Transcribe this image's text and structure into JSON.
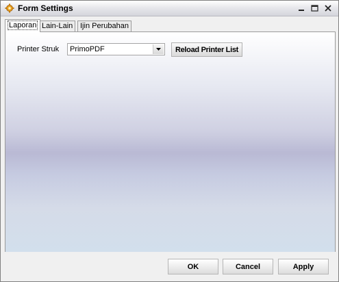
{
  "window": {
    "title": "Form Settings",
    "app_icon": "gear-icon",
    "controls": [
      "minimize-icon",
      "maximize-icon",
      "close-icon"
    ]
  },
  "tabs": [
    {
      "label": "Laporan",
      "active": true
    },
    {
      "label": "Lain-Lain",
      "active": false
    },
    {
      "label": "Ijin Perubahan",
      "active": false
    }
  ],
  "laporan": {
    "printer_label": "Printer Struk",
    "printer_value": "PrimoPDF",
    "reload_label": "Reload Printer List"
  },
  "footer": {
    "ok_label": "OK",
    "cancel_label": "Cancel",
    "apply_label": "Apply"
  }
}
